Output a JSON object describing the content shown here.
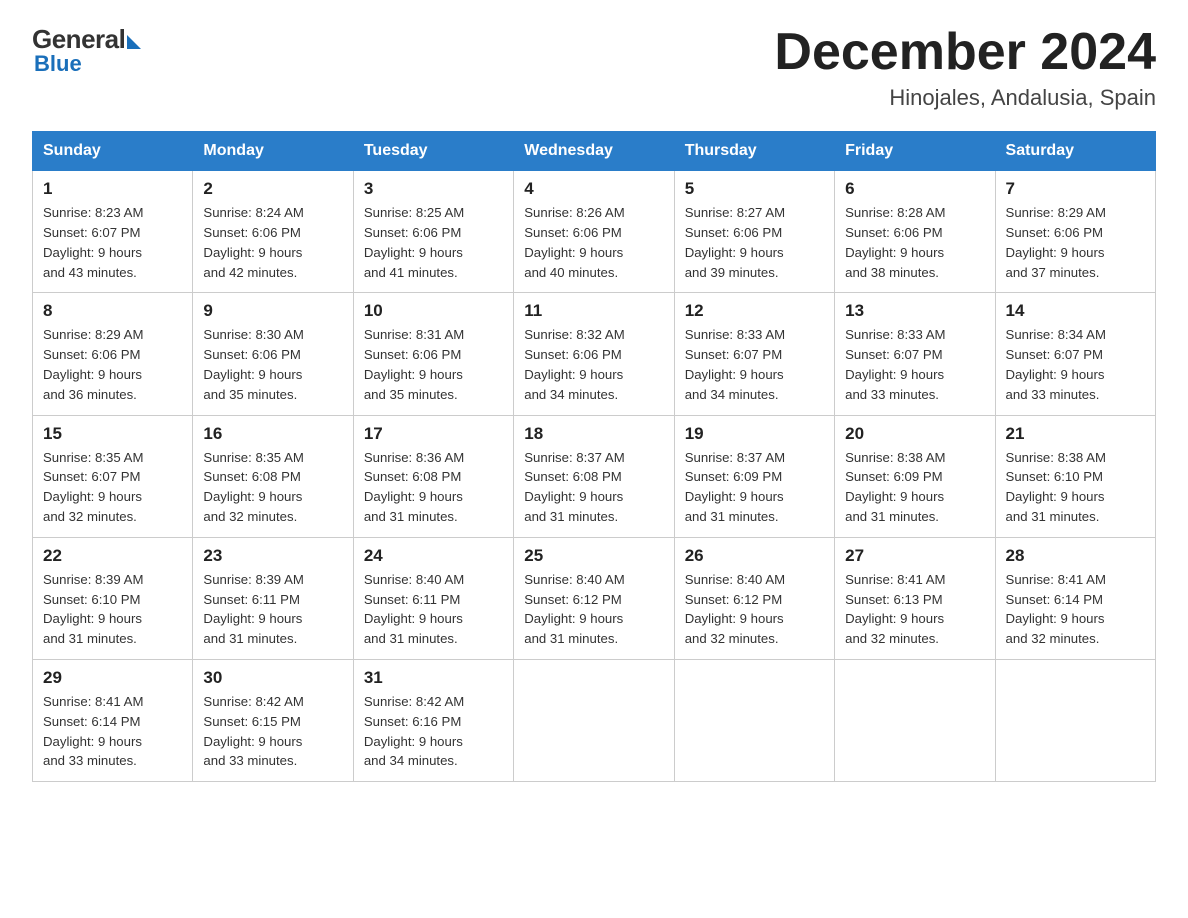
{
  "header": {
    "logo_general": "General",
    "logo_blue": "Blue",
    "title": "December 2024",
    "location": "Hinojales, Andalusia, Spain"
  },
  "days_of_week": [
    "Sunday",
    "Monday",
    "Tuesday",
    "Wednesday",
    "Thursday",
    "Friday",
    "Saturday"
  ],
  "weeks": [
    [
      {
        "day": 1,
        "sunrise": "8:23 AM",
        "sunset": "6:07 PM",
        "daylight": "9 hours and 43 minutes."
      },
      {
        "day": 2,
        "sunrise": "8:24 AM",
        "sunset": "6:06 PM",
        "daylight": "9 hours and 42 minutes."
      },
      {
        "day": 3,
        "sunrise": "8:25 AM",
        "sunset": "6:06 PM",
        "daylight": "9 hours and 41 minutes."
      },
      {
        "day": 4,
        "sunrise": "8:26 AM",
        "sunset": "6:06 PM",
        "daylight": "9 hours and 40 minutes."
      },
      {
        "day": 5,
        "sunrise": "8:27 AM",
        "sunset": "6:06 PM",
        "daylight": "9 hours and 39 minutes."
      },
      {
        "day": 6,
        "sunrise": "8:28 AM",
        "sunset": "6:06 PM",
        "daylight": "9 hours and 38 minutes."
      },
      {
        "day": 7,
        "sunrise": "8:29 AM",
        "sunset": "6:06 PM",
        "daylight": "9 hours and 37 minutes."
      }
    ],
    [
      {
        "day": 8,
        "sunrise": "8:29 AM",
        "sunset": "6:06 PM",
        "daylight": "9 hours and 36 minutes."
      },
      {
        "day": 9,
        "sunrise": "8:30 AM",
        "sunset": "6:06 PM",
        "daylight": "9 hours and 35 minutes."
      },
      {
        "day": 10,
        "sunrise": "8:31 AM",
        "sunset": "6:06 PM",
        "daylight": "9 hours and 35 minutes."
      },
      {
        "day": 11,
        "sunrise": "8:32 AM",
        "sunset": "6:06 PM",
        "daylight": "9 hours and 34 minutes."
      },
      {
        "day": 12,
        "sunrise": "8:33 AM",
        "sunset": "6:07 PM",
        "daylight": "9 hours and 34 minutes."
      },
      {
        "day": 13,
        "sunrise": "8:33 AM",
        "sunset": "6:07 PM",
        "daylight": "9 hours and 33 minutes."
      },
      {
        "day": 14,
        "sunrise": "8:34 AM",
        "sunset": "6:07 PM",
        "daylight": "9 hours and 33 minutes."
      }
    ],
    [
      {
        "day": 15,
        "sunrise": "8:35 AM",
        "sunset": "6:07 PM",
        "daylight": "9 hours and 32 minutes."
      },
      {
        "day": 16,
        "sunrise": "8:35 AM",
        "sunset": "6:08 PM",
        "daylight": "9 hours and 32 minutes."
      },
      {
        "day": 17,
        "sunrise": "8:36 AM",
        "sunset": "6:08 PM",
        "daylight": "9 hours and 31 minutes."
      },
      {
        "day": 18,
        "sunrise": "8:37 AM",
        "sunset": "6:08 PM",
        "daylight": "9 hours and 31 minutes."
      },
      {
        "day": 19,
        "sunrise": "8:37 AM",
        "sunset": "6:09 PM",
        "daylight": "9 hours and 31 minutes."
      },
      {
        "day": 20,
        "sunrise": "8:38 AM",
        "sunset": "6:09 PM",
        "daylight": "9 hours and 31 minutes."
      },
      {
        "day": 21,
        "sunrise": "8:38 AM",
        "sunset": "6:10 PM",
        "daylight": "9 hours and 31 minutes."
      }
    ],
    [
      {
        "day": 22,
        "sunrise": "8:39 AM",
        "sunset": "6:10 PM",
        "daylight": "9 hours and 31 minutes."
      },
      {
        "day": 23,
        "sunrise": "8:39 AM",
        "sunset": "6:11 PM",
        "daylight": "9 hours and 31 minutes."
      },
      {
        "day": 24,
        "sunrise": "8:40 AM",
        "sunset": "6:11 PM",
        "daylight": "9 hours and 31 minutes."
      },
      {
        "day": 25,
        "sunrise": "8:40 AM",
        "sunset": "6:12 PM",
        "daylight": "9 hours and 31 minutes."
      },
      {
        "day": 26,
        "sunrise": "8:40 AM",
        "sunset": "6:12 PM",
        "daylight": "9 hours and 32 minutes."
      },
      {
        "day": 27,
        "sunrise": "8:41 AM",
        "sunset": "6:13 PM",
        "daylight": "9 hours and 32 minutes."
      },
      {
        "day": 28,
        "sunrise": "8:41 AM",
        "sunset": "6:14 PM",
        "daylight": "9 hours and 32 minutes."
      }
    ],
    [
      {
        "day": 29,
        "sunrise": "8:41 AM",
        "sunset": "6:14 PM",
        "daylight": "9 hours and 33 minutes."
      },
      {
        "day": 30,
        "sunrise": "8:42 AM",
        "sunset": "6:15 PM",
        "daylight": "9 hours and 33 minutes."
      },
      {
        "day": 31,
        "sunrise": "8:42 AM",
        "sunset": "6:16 PM",
        "daylight": "9 hours and 34 minutes."
      },
      null,
      null,
      null,
      null
    ]
  ],
  "labels": {
    "sunrise": "Sunrise:",
    "sunset": "Sunset:",
    "daylight": "Daylight:"
  }
}
